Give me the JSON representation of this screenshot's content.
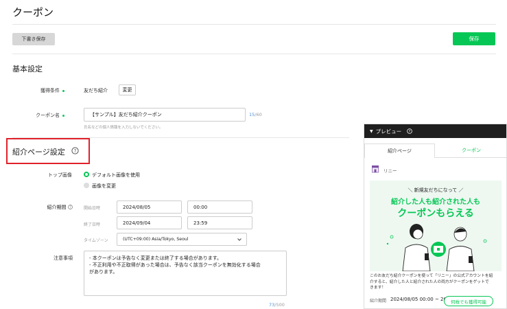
{
  "page": {
    "title": "クーポン"
  },
  "toolbar": {
    "draft_label": "下書き保存",
    "save_label": "保存"
  },
  "basic": {
    "heading": "基本設定",
    "condition_label": "獲得条件",
    "condition_value": "友だち紹介",
    "change_label": "変更",
    "name_label": "クーポン名",
    "name_value": "【サンプル】友だち紹介クーポン",
    "name_count": "15",
    "name_max": "/60",
    "name_hint": "氏名などの個人情報を入力しないでください。"
  },
  "intro": {
    "heading": "紹介ページ設定",
    "top_image_label": "トップ画像",
    "option_default": "デフォルト画像を使用",
    "option_change": "画像を変更",
    "period_label": "紹介期間",
    "start_label": "開始日時",
    "start_date": "2024/08/05",
    "start_time": "00:00",
    "end_label": "終了日時",
    "end_date": "2024/09/04",
    "end_time": "23:59",
    "tz_label": "タイムゾーン",
    "tz_value": "(UTC+09:00) Asia/Tokyo, Seoul",
    "notes_label": "注意事項",
    "notes_line1": "- 本クーポンは予告なく変更または終了する場合があります。",
    "notes_line2": "- 不正利用や不正取得があった場合は、予告なく該当クーポンを無効化する場合",
    "notes_line3": "があります。",
    "notes_count": "73",
    "notes_max": "/500"
  },
  "preview": {
    "title": "プレビュー",
    "tab_intro": "紹介ページ",
    "tab_coupon": "クーポン",
    "shop": "リニー",
    "banner_line1": "＼ 新規友だちになって ／",
    "banner_line2": "紹介した人も紹介された人も",
    "banner_line3": "クーポンもらえる",
    "body_line1": "このお友だち紹介クーポンを使って「リニー」の公式アカウントを紹",
    "body_line2": "介すると、紹介した人と紹介された人の両方がクーポンをゲットで",
    "body_line3": "きます！",
    "period_label": "紹介期間",
    "period_value": "2024/08/05 00:00 ~ 20",
    "chip": "何枚でも獲得可能"
  },
  "colors": {
    "accent": "#06c755",
    "highlight": "#e0202a",
    "preview_header": "#1f1f1f"
  },
  "icons": [
    "help-circle-icon",
    "chevron-down-icon",
    "triangle-down-icon",
    "shop-icon",
    "coupon-ticket-icon"
  ]
}
